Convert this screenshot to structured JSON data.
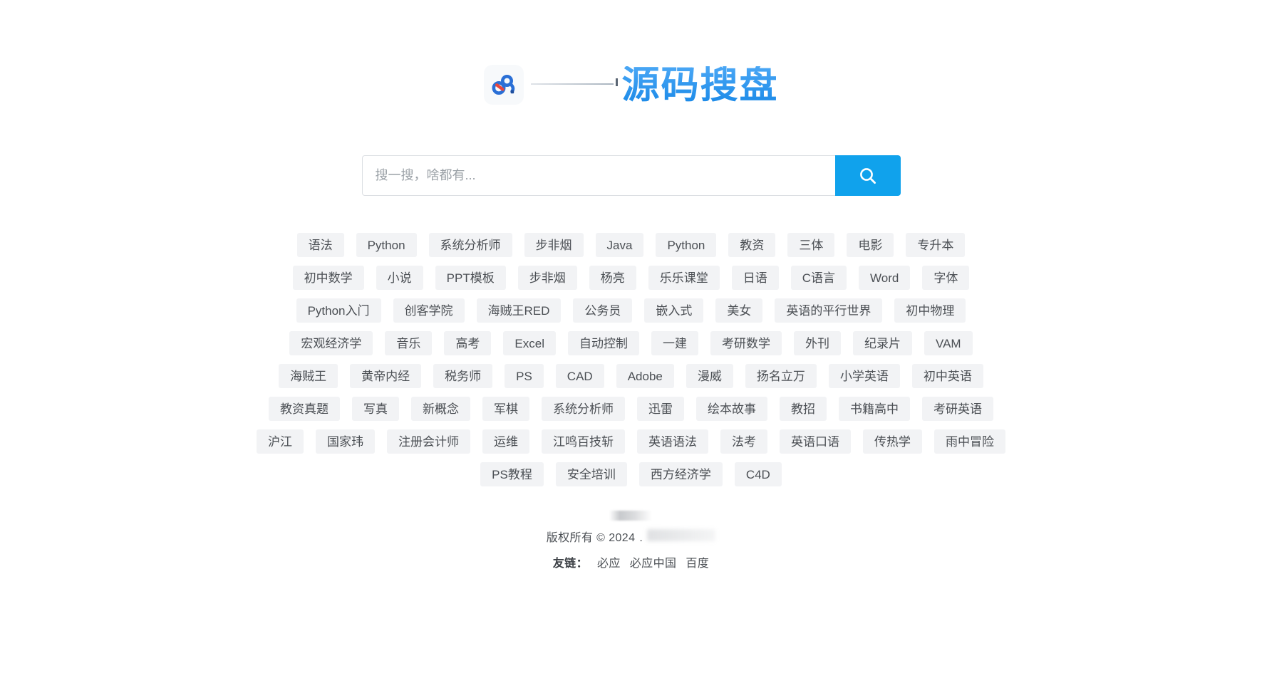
{
  "brand": {
    "logo_icon": "baidu-cloud-logo-icon",
    "divider_icon": "horizontal-rule-decoration",
    "title": "源码搜盘"
  },
  "search": {
    "value": "",
    "placeholder": "搜一搜，啥都有...",
    "button_icon": "search-icon",
    "button_label": ""
  },
  "tag_rows": [
    [
      "语法",
      "Python",
      "系统分析师",
      "步非烟",
      "Java",
      "Python",
      "教资",
      "三体",
      "电影",
      "专升本"
    ],
    [
      "初中数学",
      "小说",
      "PPT模板",
      "步非烟",
      "杨亮",
      "乐乐课堂",
      "日语",
      "C语言",
      "Word",
      "字体"
    ],
    [
      "Python入门",
      "创客学院",
      "海贼王RED",
      "公务员",
      "嵌入式",
      "美女",
      "英语的平行世界",
      "初中物理"
    ],
    [
      "宏观经济学",
      "音乐",
      "高考",
      "Excel",
      "自动控制",
      "一建",
      "考研数学",
      "外刊",
      "纪录片",
      "VAM"
    ],
    [
      "海贼王",
      "黄帝内经",
      "税务师",
      "PS",
      "CAD",
      "Adobe",
      "漫威",
      "扬名立万",
      "小学英语",
      "初中英语"
    ],
    [
      "教资真题",
      "写真",
      "新概念",
      "军棋",
      "系统分析师",
      "迅雷",
      "绘本故事",
      "教招",
      "书籍高中",
      "考研英语"
    ],
    [
      "沪江",
      "国家玮",
      "注册会计师",
      "运维",
      "江鸣百技斩",
      "英语语法",
      "法考",
      "英语口语",
      "传热学",
      "雨中冒险"
    ],
    [
      "PS教程",
      "安全培训",
      "西方经济学",
      "C4D"
    ]
  ],
  "footer": {
    "copyright_prefix": "版权所有 © 2024",
    "copyright_suffix": ".",
    "links_label": "友链：",
    "links": [
      "必应",
      "必应中国",
      "百度"
    ]
  },
  "colors": {
    "accent": "#10a2ec",
    "title": "#2196f3",
    "tag_bg": "#f2f3f5",
    "tag_text": "#4b4f54",
    "page_bg": "#ffffff"
  }
}
